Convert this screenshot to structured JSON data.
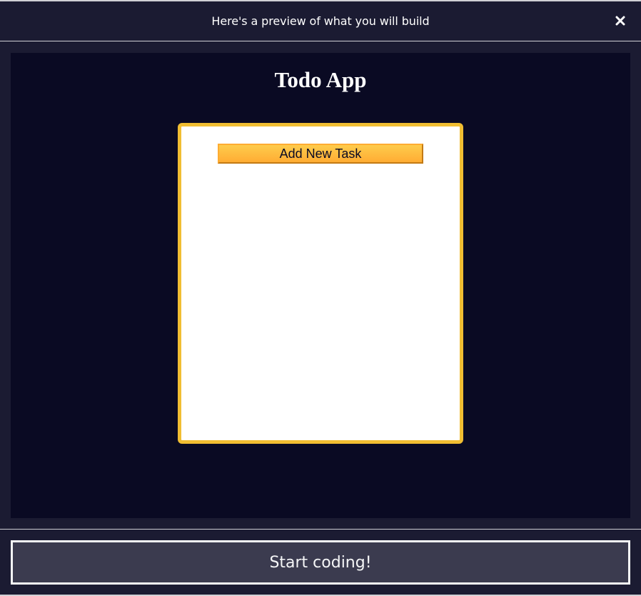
{
  "header": {
    "title": "Here's a preview of what you will build",
    "close_icon": "close-icon"
  },
  "preview": {
    "app_title": "Todo App",
    "add_task_label": "Add New Task"
  },
  "footer": {
    "start_label": "Start coding!"
  },
  "colors": {
    "modal_bg": "#1b1b32",
    "preview_bg": "#0a0a23",
    "card_border": "#f1be32",
    "button_gradient_top": "#fecc4c",
    "button_gradient_bottom": "#ffac33",
    "start_button_bg": "#3b3b4f"
  }
}
